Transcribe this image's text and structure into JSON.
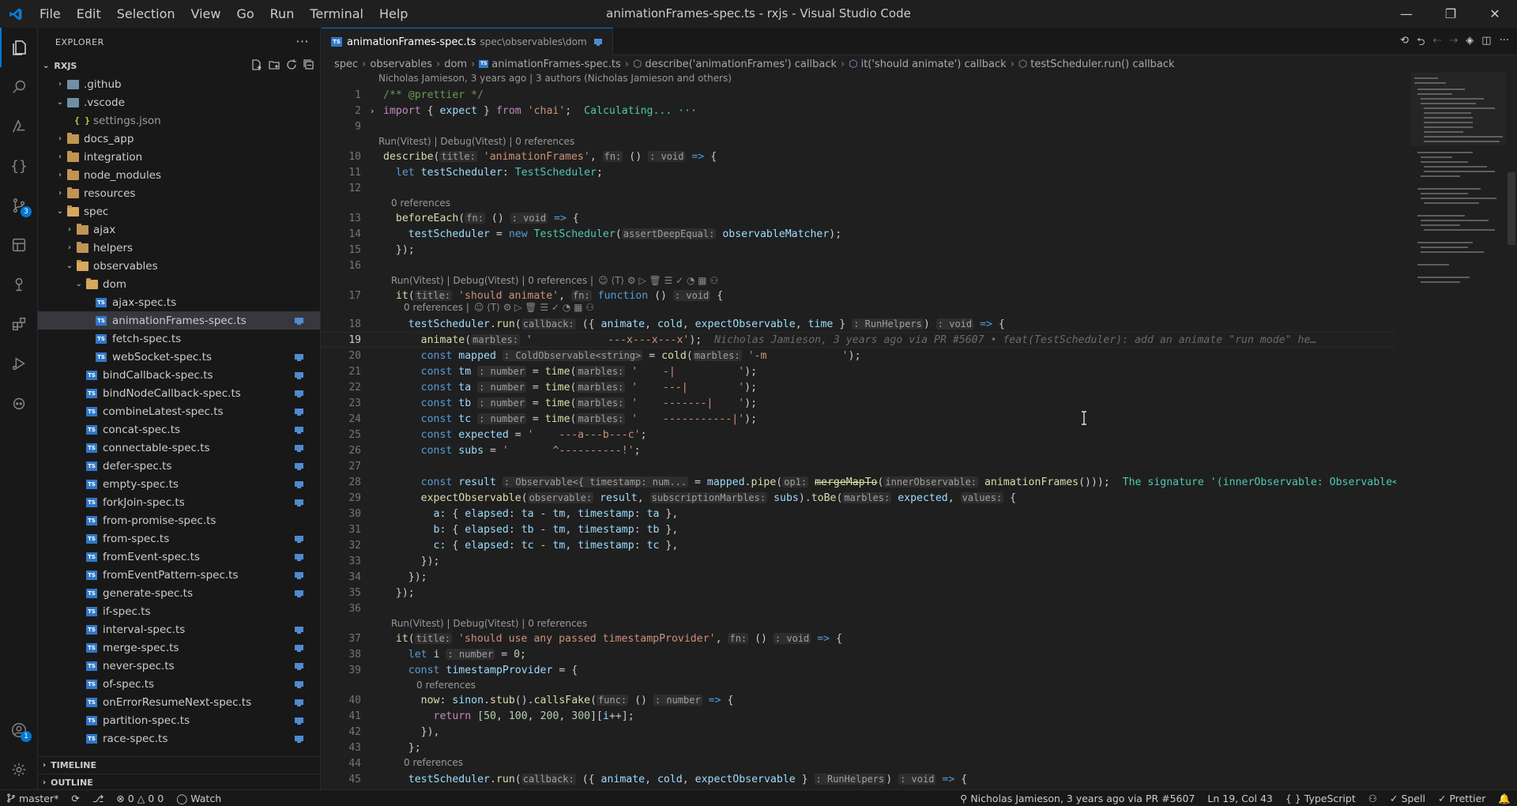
{
  "window": {
    "title": "animationFrames-spec.ts - rxjs - Visual Studio Code"
  },
  "menu": [
    "File",
    "Edit",
    "Selection",
    "View",
    "Go",
    "Run",
    "Terminal",
    "Help"
  ],
  "activity": {
    "scm_badge": "3",
    "accounts_badge": "1"
  },
  "sidebar": {
    "header": "EXPLORER",
    "root": "RXJS",
    "tree": [
      {
        "label": ".github",
        "kind": "gear-folder",
        "depth": 1,
        "chev": "›"
      },
      {
        "label": ".vscode",
        "kind": "gear-folder",
        "depth": 1,
        "chev": "⌄"
      },
      {
        "label": "settings.json",
        "kind": "json",
        "depth": 2,
        "chev": ""
      },
      {
        "label": "docs_app",
        "kind": "folder",
        "depth": 1,
        "chev": "›"
      },
      {
        "label": "integration",
        "kind": "folder",
        "depth": 1,
        "chev": "›"
      },
      {
        "label": "node_modules",
        "kind": "folder",
        "depth": 1,
        "chev": "›"
      },
      {
        "label": "resources",
        "kind": "folder",
        "depth": 1,
        "chev": "›"
      },
      {
        "label": "spec",
        "kind": "folder",
        "depth": 1,
        "chev": "⌄"
      },
      {
        "label": "ajax",
        "kind": "folder",
        "depth": 2,
        "chev": "›"
      },
      {
        "label": "helpers",
        "kind": "folder",
        "depth": 2,
        "chev": "›"
      },
      {
        "label": "observables",
        "kind": "folder",
        "depth": 2,
        "chev": "⌄"
      },
      {
        "label": "dom",
        "kind": "folder",
        "depth": 3,
        "chev": "⌄"
      },
      {
        "label": "ajax-spec.ts",
        "kind": "ts",
        "depth": 4,
        "chev": ""
      },
      {
        "label": "animationFrames-spec.ts",
        "kind": "ts",
        "depth": 4,
        "chev": "",
        "selected": true,
        "dec": true
      },
      {
        "label": "fetch-spec.ts",
        "kind": "ts",
        "depth": 4,
        "chev": ""
      },
      {
        "label": "webSocket-spec.ts",
        "kind": "ts",
        "depth": 4,
        "chev": "",
        "dec": true
      },
      {
        "label": "bindCallback-spec.ts",
        "kind": "ts",
        "depth": 3,
        "chev": "",
        "dec": true
      },
      {
        "label": "bindNodeCallback-spec.ts",
        "kind": "ts",
        "depth": 3,
        "chev": "",
        "dec": true
      },
      {
        "label": "combineLatest-spec.ts",
        "kind": "ts",
        "depth": 3,
        "chev": "",
        "dec": true
      },
      {
        "label": "concat-spec.ts",
        "kind": "ts",
        "depth": 3,
        "chev": "",
        "dec": true
      },
      {
        "label": "connectable-spec.ts",
        "kind": "ts",
        "depth": 3,
        "chev": "",
        "dec": true
      },
      {
        "label": "defer-spec.ts",
        "kind": "ts",
        "depth": 3,
        "chev": "",
        "dec": true
      },
      {
        "label": "empty-spec.ts",
        "kind": "ts",
        "depth": 3,
        "chev": "",
        "dec": true
      },
      {
        "label": "forkJoin-spec.ts",
        "kind": "ts",
        "depth": 3,
        "chev": "",
        "dec": true
      },
      {
        "label": "from-promise-spec.ts",
        "kind": "ts",
        "depth": 3,
        "chev": ""
      },
      {
        "label": "from-spec.ts",
        "kind": "ts",
        "depth": 3,
        "chev": "",
        "dec": true
      },
      {
        "label": "fromEvent-spec.ts",
        "kind": "ts",
        "depth": 3,
        "chev": "",
        "dec": true
      },
      {
        "label": "fromEventPattern-spec.ts",
        "kind": "ts",
        "depth": 3,
        "chev": "",
        "dec": true
      },
      {
        "label": "generate-spec.ts",
        "kind": "ts",
        "depth": 3,
        "chev": "",
        "dec": true
      },
      {
        "label": "if-spec.ts",
        "kind": "ts",
        "depth": 3,
        "chev": ""
      },
      {
        "label": "interval-spec.ts",
        "kind": "ts",
        "depth": 3,
        "chev": "",
        "dec": true
      },
      {
        "label": "merge-spec.ts",
        "kind": "ts",
        "depth": 3,
        "chev": "",
        "dec": true
      },
      {
        "label": "never-spec.ts",
        "kind": "ts",
        "depth": 3,
        "chev": "",
        "dec": true
      },
      {
        "label": "of-spec.ts",
        "kind": "ts",
        "depth": 3,
        "chev": "",
        "dec": true
      },
      {
        "label": "onErrorResumeNext-spec.ts",
        "kind": "ts",
        "depth": 3,
        "chev": "",
        "dec": true
      },
      {
        "label": "partition-spec.ts",
        "kind": "ts",
        "depth": 3,
        "chev": "",
        "dec": true
      },
      {
        "label": "race-spec.ts",
        "kind": "ts",
        "depth": 3,
        "chev": "",
        "dec": true
      }
    ],
    "timeline": "TIMELINE",
    "outline": "OUTLINE"
  },
  "tab": {
    "label": "animationFrames-spec.ts",
    "desc": "spec\\observables\\dom"
  },
  "breadcrumb": [
    "spec",
    "observables",
    "dom",
    "animationFrames-spec.ts",
    "describe('animationFrames') callback",
    "it('should animate') callback",
    "testScheduler.run() callback"
  ],
  "code": {
    "blame_header": "Nicholas Jamieson, 3 years ago | 3 authors (Nicholas Jamieson and others)",
    "lenses": {
      "l10": "Run(Vitest) | Debug(Vitest) | 0 references",
      "l13": "0 references",
      "l17": "Run(Vitest) | Debug(Vitest) | 0 references |",
      "l18": "0 references |",
      "l37": "Run(Vitest) | Debug(Vitest) | 0 references",
      "l40": "0 references",
      "l45": "0 references"
    },
    "blame_inline": "Nicholas Jamieson, 3 years ago via PR #5607 • feat(TestScheduler): add an animate \"run mode\" he…",
    "calculating": "Calculating...",
    "inline_error": "The signature '(innerObservable: Observable<"
  },
  "status": {
    "branch": "master*",
    "errors": "0",
    "warnings": "0",
    "info": "0",
    "watch": "Watch",
    "blame": "Nicholas Jamieson, 3 years ago via PR #5607",
    "position": "Ln 19, Col 43",
    "language": "TypeScript",
    "spell": "Spell",
    "prettier": "Prettier"
  }
}
